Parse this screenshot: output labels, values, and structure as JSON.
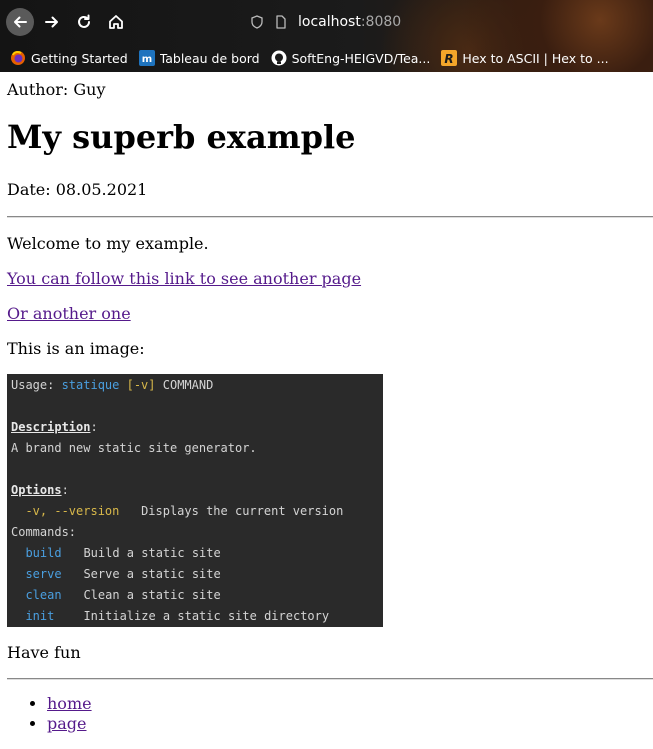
{
  "browser": {
    "url_host": "localhost",
    "url_port": ":8080",
    "bookmarks": [
      {
        "label": "Getting Started",
        "icon": "firefox-icon"
      },
      {
        "label": "Tableau de bord",
        "icon": "dashboard-icon"
      },
      {
        "label": "SoftEng-HEIGVD/Tea...",
        "icon": "github-icon"
      },
      {
        "label": "Hex to ASCII | Hex to ...",
        "icon": "r-icon"
      }
    ]
  },
  "page": {
    "author": "Author: Guy",
    "title": "My superb example",
    "date": "Date: 08.05.2021",
    "welcome": "Welcome to my example.",
    "link1": "You can follow this link to see another page",
    "link2": "Or another one",
    "image_intro": "This is an image:",
    "outro": "Have fun",
    "nav": [
      "home",
      "page"
    ]
  },
  "terminal": {
    "usage_prefix": "Usage: ",
    "usage_cmd": "statique",
    "usage_flag": "[-v]",
    "usage_rest": " COMMAND",
    "description_label": "Description",
    "description_colon": ":",
    "description_text": "A brand new static site generator.",
    "options_label": "Options",
    "options_colon": ":",
    "option_flag": "-v, --version",
    "option_desc": "Displays the current version",
    "commands_label": "Commands:",
    "commands": [
      {
        "name": "build",
        "desc": "Build a static site"
      },
      {
        "name": "serve",
        "desc": "Serve a static site"
      },
      {
        "name": "clean",
        "desc": "Clean a static site"
      },
      {
        "name": "init",
        "desc": "Initialize a static site directory"
      }
    ]
  },
  "colors": {
    "link": "#551a8b",
    "terminal_bg": "#2a2a2a",
    "terminal_blue": "#4a9fe0",
    "terminal_yellow": "#d8b84a"
  }
}
